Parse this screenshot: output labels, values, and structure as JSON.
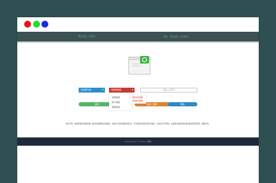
{
  "brand": {
    "name": "微信群二维码"
  },
  "nav": [
    "首页",
    "使用说明",
    "联系我们"
  ],
  "selects": {
    "left": "请选择分类",
    "middle": "请选择地区"
  },
  "search": {
    "placeholder": "请输入关键词"
  },
  "dropdown": {
    "options": [
      "全部地区",
      "热门地区",
      "其他地区"
    ],
    "submenu": [
      "按省份选择",
      "按城市选择"
    ]
  },
  "buttons": {
    "green": "搜索",
    "orange": "提交二维码",
    "blue": "帮助"
  },
  "description": "免责声明：本站所收录的微信群二维码均由网友自由提交，本站不对其内容的真实性、合法性及有效性作任何保证，请用户自行辨别，如发现违规内容请及时联系我们处理，谢谢合作。",
  "footer": {
    "text": "Powered by © 2019 · 微信"
  },
  "colors": {
    "background": "#2e5052",
    "header": "#3b5153",
    "footer": "#1e2a3a",
    "select_blue": "#2a8fce",
    "select_red": "#c83a33",
    "button_green": "#56b466",
    "button_orange": "#e0822f",
    "button_blue": "#2e88c5",
    "wechat_green": "#3fb641"
  }
}
